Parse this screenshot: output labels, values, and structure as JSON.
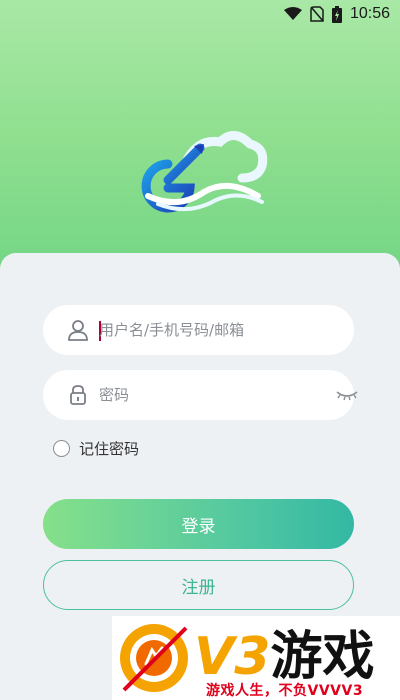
{
  "status_bar": {
    "time": "10:56",
    "icons": [
      "wifi-icon",
      "no-sim-icon",
      "battery-charging-icon"
    ]
  },
  "logo": {
    "icon": "cloud-e-logo-icon"
  },
  "login_form": {
    "username": {
      "placeholder": "用户名/手机号码/邮箱",
      "value": "",
      "icon": "user-icon"
    },
    "password": {
      "placeholder": "密码",
      "value": "",
      "icon": "lock-icon",
      "toggle_icon": "eye-closed-icon"
    },
    "remember": {
      "label": "记住密码",
      "checked": false
    },
    "login_label": "登录",
    "register_label": "注册"
  },
  "watermark": {
    "brand_v3": "V3",
    "brand_cn": "游戏",
    "slogan": "游戏人生，不负VVVV3"
  },
  "colors": {
    "accent_green": "#86e08a",
    "accent_teal": "#33b8a4",
    "card_bg": "#eef1f4",
    "brand_orange": "#f06a00",
    "slogan_red": "#e0001b"
  }
}
